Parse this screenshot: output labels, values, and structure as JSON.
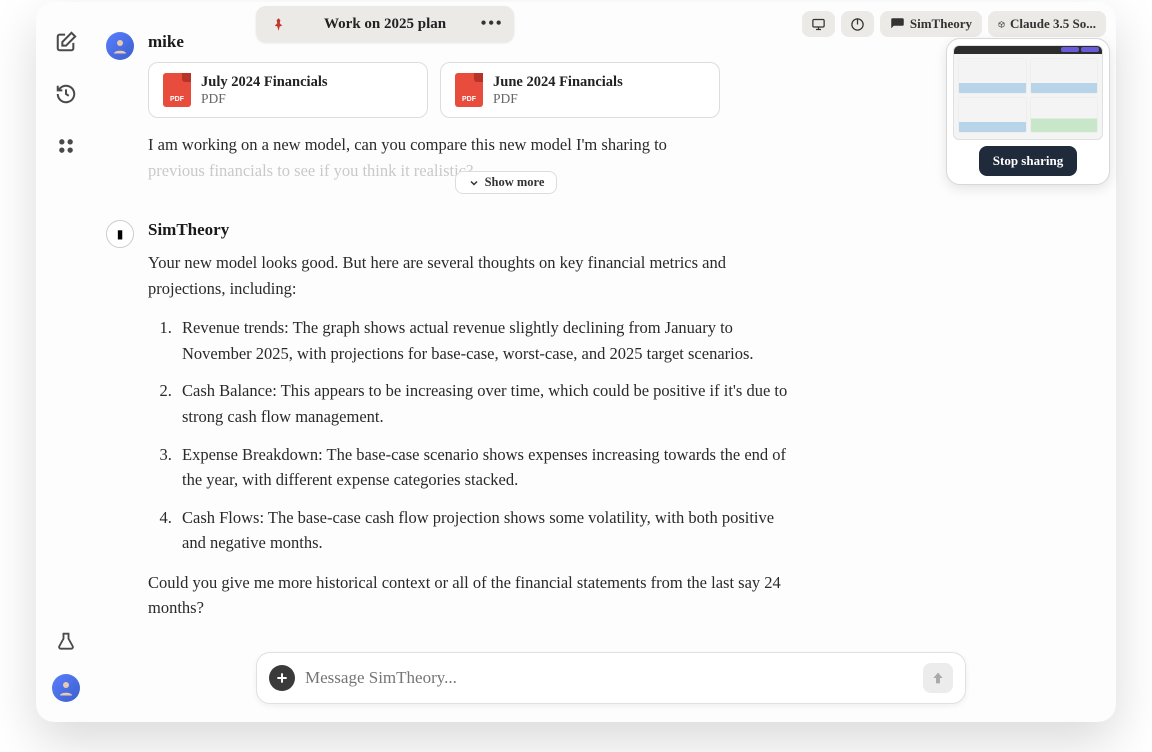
{
  "header": {
    "title": "Work on 2025 plan",
    "chips": {
      "assistant_name": "SimTheory",
      "model_name": "Claude 3.5 So..."
    }
  },
  "share_preview": {
    "stop_label": "Stop sharing"
  },
  "messages": {
    "user": {
      "name": "mike",
      "attachments": [
        {
          "title": "July 2024 Financials",
          "type": "PDF"
        },
        {
          "title": "June 2024 Financials",
          "type": "PDF"
        }
      ],
      "line1": "I am working on a new model, can you compare this new model I'm sharing to",
      "line2_faded": "previous financials to see if you think it realistic?",
      "show_more": "Show more"
    },
    "bot": {
      "name": "SimTheory",
      "intro": "Your new model looks good. But here are several thoughts on key financial metrics and projections, including:",
      "points": [
        "Revenue trends: The graph shows actual revenue slightly declining from January to November 2025, with projections for base-case, worst-case, and 2025 target scenarios.",
        "Cash Balance: This appears to be increasing over time, which could be positive if it's due to strong cash flow management.",
        "Expense Breakdown: The base-case scenario shows expenses increasing towards the end of the year, with different expense categories stacked.",
        "Cash Flows: The base-case cash flow projection shows some volatility, with both positive and negative months."
      ],
      "outro": "Could you give me more historical context or all of the financial statements from the last say 24 months?"
    }
  },
  "composer": {
    "placeholder": "Message SimTheory..."
  },
  "icons": {
    "pdf_label": "PDF"
  }
}
